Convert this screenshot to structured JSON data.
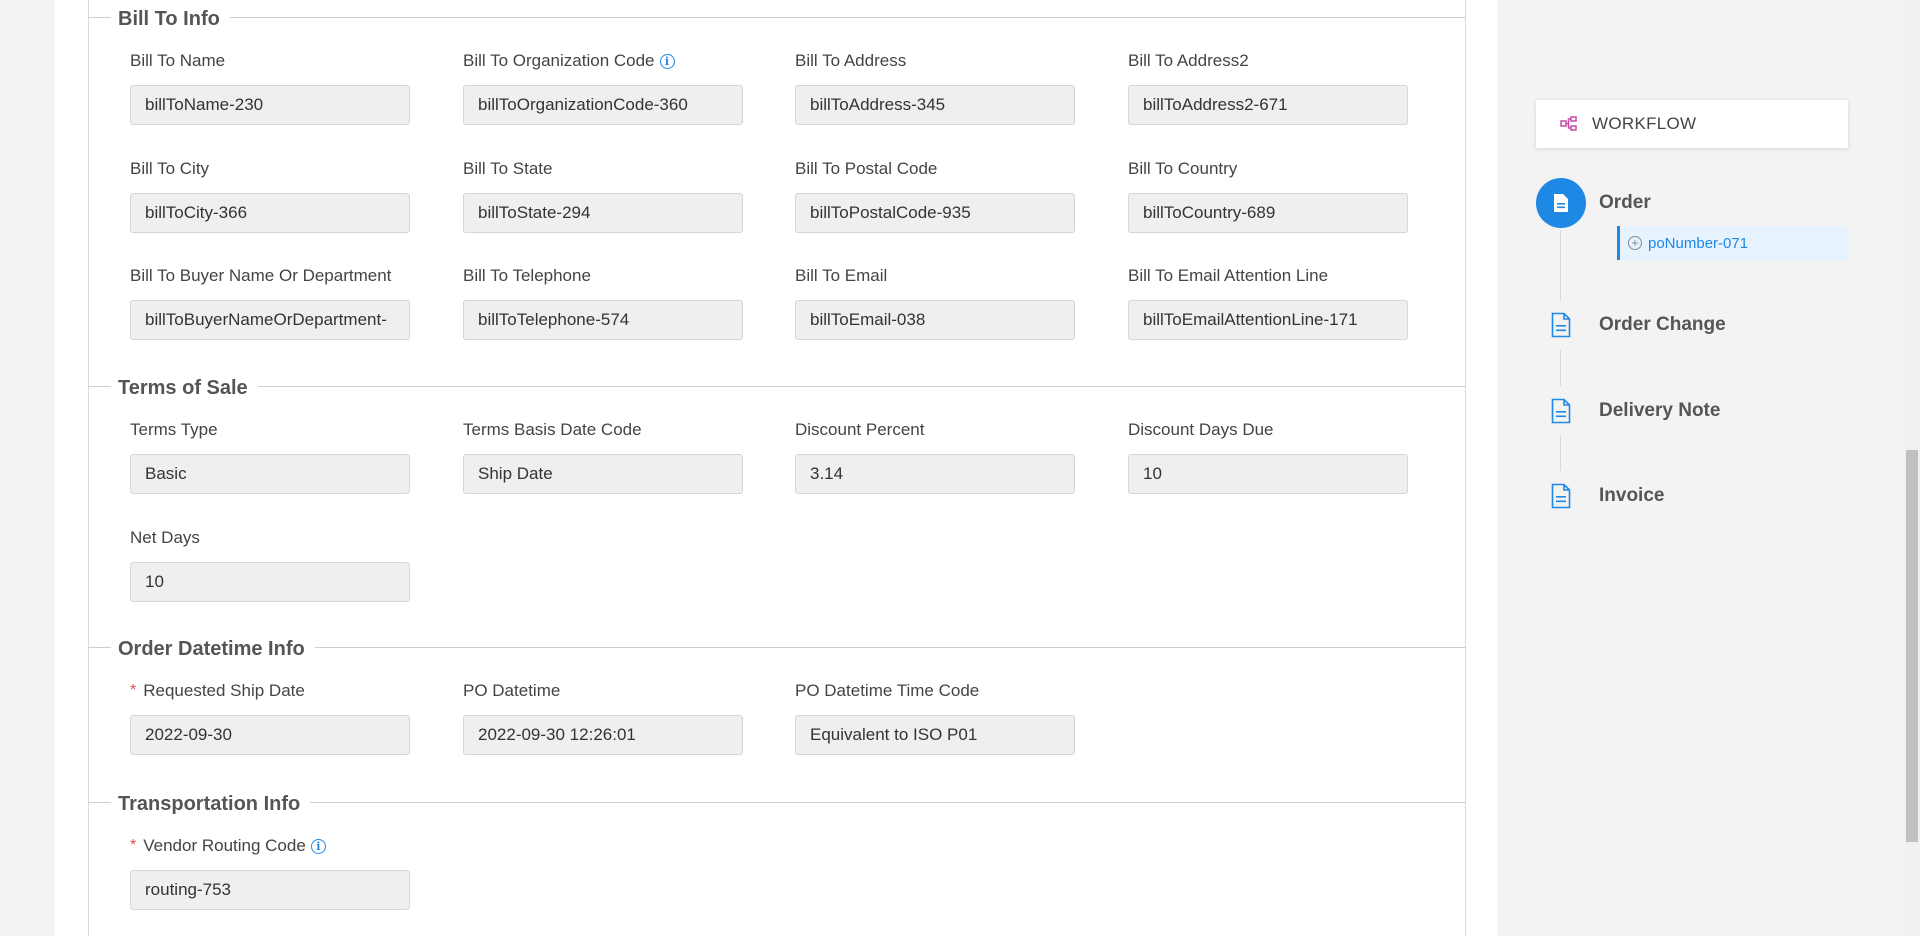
{
  "sections": {
    "bill_to": {
      "title": "Bill To Info",
      "fields": [
        {
          "label": "Bill To Name",
          "value": "billToName-230"
        },
        {
          "label": "Bill To Organization Code",
          "value": "billToOrganizationCode-360"
        },
        {
          "label": "Bill To Address",
          "value": "billToAddress-345"
        },
        {
          "label": "Bill To Address2",
          "value": "billToAddress2-671"
        },
        {
          "label": "Bill To City",
          "value": "billToCity-366"
        },
        {
          "label": "Bill To State",
          "value": "billToState-294"
        },
        {
          "label": "Bill To Postal Code",
          "value": "billToPostalCode-935"
        },
        {
          "label": "Bill To Country",
          "value": "billToCountry-689"
        },
        {
          "label": "Bill To Buyer Name Or Department",
          "value": "billToBuyerNameOrDepartment-"
        },
        {
          "label": "Bill To Telephone",
          "value": "billToTelephone-574"
        },
        {
          "label": "Bill To Email",
          "value": "billToEmail-038"
        },
        {
          "label": "Bill To Email Attention Line",
          "value": "billToEmailAttentionLine-171"
        }
      ]
    },
    "terms": {
      "title": "Terms of Sale",
      "fields": [
        {
          "label": "Terms Type",
          "value": "Basic"
        },
        {
          "label": "Terms Basis Date Code",
          "value": "Ship Date"
        },
        {
          "label": "Discount Percent",
          "value": "3.14"
        },
        {
          "label": "Discount Days Due",
          "value": "10"
        },
        {
          "label": "Net Days",
          "value": "10"
        }
      ]
    },
    "order_datetime": {
      "title": "Order Datetime Info",
      "fields": [
        {
          "label": "Requested Ship Date",
          "value": "2022-09-30"
        },
        {
          "label": "PO Datetime",
          "value": "2022-09-30 12:26:01"
        },
        {
          "label": "PO Datetime Time Code",
          "value": "Equivalent to ISO P01"
        }
      ]
    },
    "transportation": {
      "title": "Transportation Info",
      "fields": [
        {
          "label": "Vendor Routing Code",
          "value": "routing-753"
        }
      ]
    }
  },
  "required_mark": "*",
  "info_glyph": "i",
  "workflow": {
    "header": "WORKFLOW",
    "steps": [
      {
        "label": "Order",
        "icon": "document-icon",
        "active": true
      },
      {
        "label": "Order Change",
        "icon": "document-outline-icon"
      },
      {
        "label": "Delivery Note",
        "icon": "document-outline-icon"
      },
      {
        "label": "Invoice",
        "icon": "document-outline-icon"
      }
    ],
    "sub_item": "poNumber-071",
    "plus_glyph": "+"
  },
  "colors": {
    "accent": "#1e88e5",
    "required": "#e84a4a",
    "workflow_icon": "#c94aa8"
  }
}
